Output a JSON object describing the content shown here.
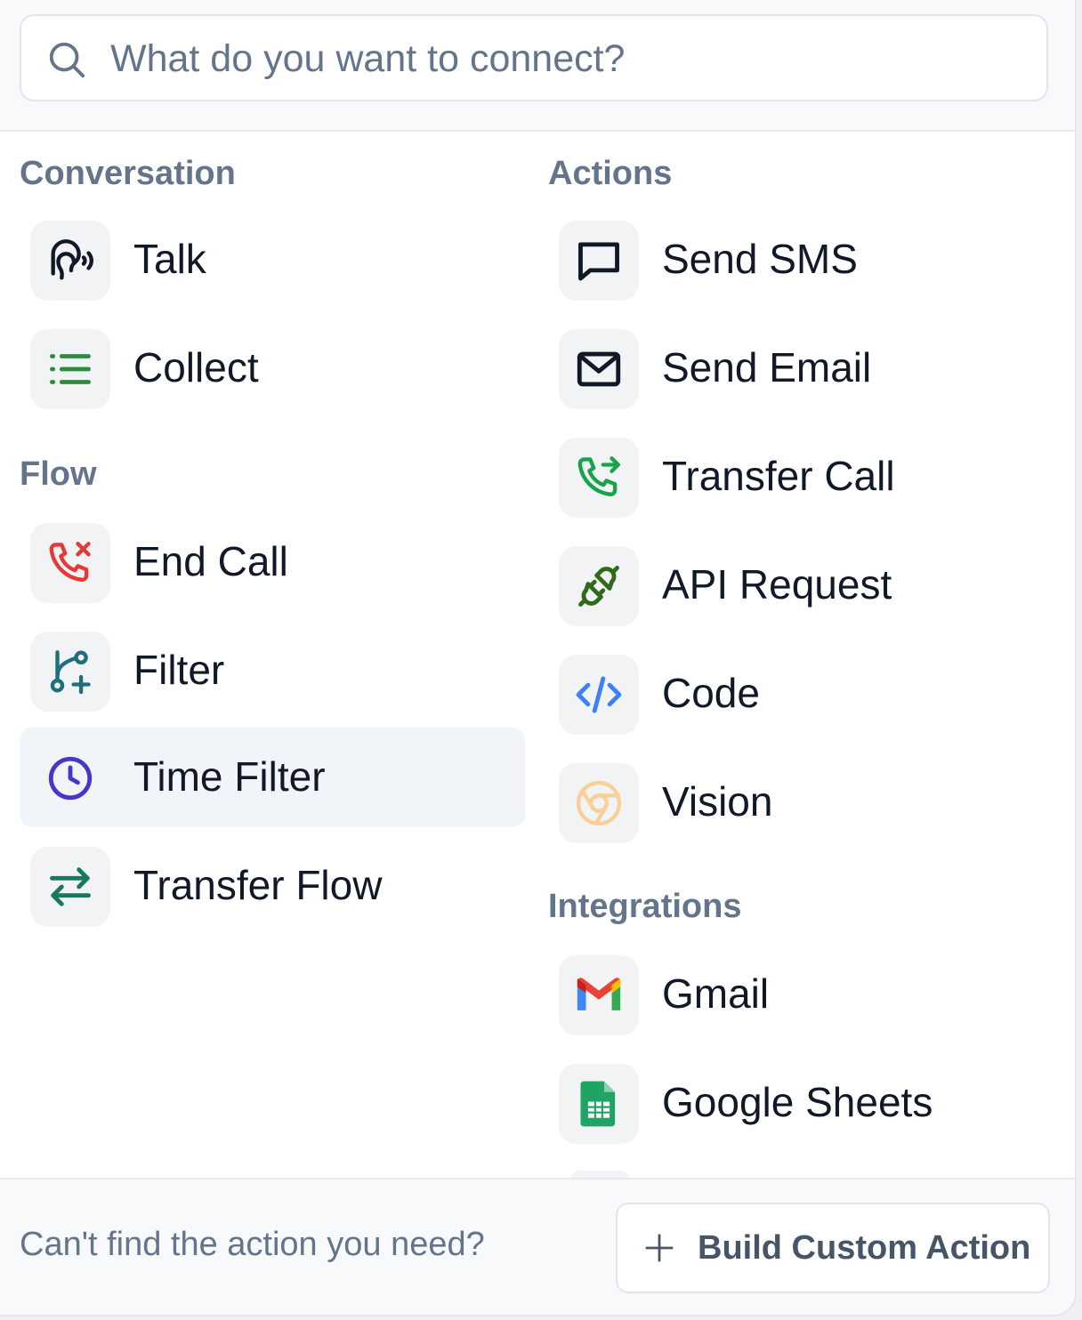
{
  "search": {
    "placeholder": "What do you want to connect?"
  },
  "sections": {
    "conversation": {
      "title": "Conversation",
      "items": [
        {
          "label": "Talk",
          "icon": "talk-icon"
        },
        {
          "label": "Collect",
          "icon": "list-icon"
        }
      ]
    },
    "flow": {
      "title": "Flow",
      "items": [
        {
          "label": "End Call",
          "icon": "end-call-icon"
        },
        {
          "label": "Filter",
          "icon": "branch-icon"
        },
        {
          "label": "Time Filter",
          "icon": "clock-icon",
          "selected": true
        },
        {
          "label": "Transfer Flow",
          "icon": "arrows-transfer-icon"
        }
      ]
    },
    "actions": {
      "title": "Actions",
      "items": [
        {
          "label": "Send SMS",
          "icon": "message-icon"
        },
        {
          "label": "Send Email",
          "icon": "envelope-icon"
        },
        {
          "label": "Transfer Call",
          "icon": "phone-transfer-icon"
        },
        {
          "label": "API Request",
          "icon": "plug-icon"
        },
        {
          "label": "Code",
          "icon": "code-icon"
        },
        {
          "label": "Vision",
          "icon": "vision-icon"
        }
      ]
    },
    "integrations": {
      "title": "Integrations",
      "items": [
        {
          "label": "Gmail",
          "icon": "gmail-icon"
        },
        {
          "label": "Google Sheets",
          "icon": "google-sheets-icon"
        }
      ]
    }
  },
  "footer": {
    "prompt": "Can't find the action you need?",
    "button_label": "Build Custom Action",
    "button_icon": "plus-icon"
  },
  "colors": {
    "collect": "#2e8b3d",
    "end_call": "#e53935",
    "filter": "#1e6f7c",
    "time_filter": "#4338ca",
    "transfer_flow": "#177a5c",
    "transfer_call": "#16a34a",
    "api": "#2f6b1c",
    "code": "#3b82f6",
    "vision": "#fbcf97"
  }
}
